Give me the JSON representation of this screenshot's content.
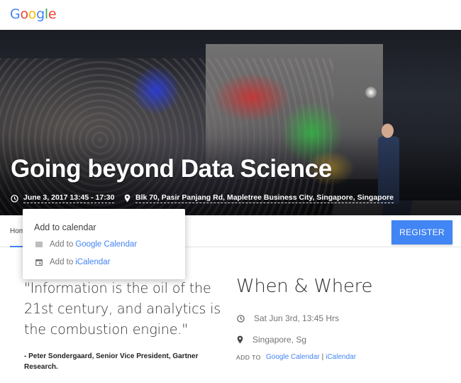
{
  "header": {
    "logo_letters": [
      {
        "ch": "G",
        "color": "#4285f4"
      },
      {
        "ch": "o",
        "color": "#ea4335"
      },
      {
        "ch": "o",
        "color": "#fbbc05"
      },
      {
        "ch": "g",
        "color": "#4285f4"
      },
      {
        "ch": "l",
        "color": "#34a853"
      },
      {
        "ch": "e",
        "color": "#ea4335"
      }
    ]
  },
  "hero": {
    "title": "Going beyond Data Science",
    "datetime": "June 3, 2017 13:45 - 17:30",
    "location": "Blk 70, Pasir Panjang Rd, Mapletree Business City, Singapore, Singapore",
    "datetime_icon": "clock-icon",
    "location_icon": "location-pin-icon"
  },
  "nav": {
    "home_label": "Hom",
    "register_label": "REGISTER"
  },
  "calendar_popup": {
    "title": "Add to calendar",
    "items": [
      {
        "prefix": "Add to",
        "link": "Google Calendar",
        "icon": "google-calendar-icon"
      },
      {
        "prefix": "Add to",
        "link": "iCalendar",
        "icon": "calendar-icon"
      }
    ]
  },
  "quote": {
    "text": "\"Information is the oil of the 21st century, and analytics is the combustion engine.\"",
    "author": "- Peter Sondergaard, Senior Vice President, Gartner Research."
  },
  "when_where": {
    "title": "When & Where",
    "date": "Sat Jun 3rd, 13:45 Hrs",
    "place": "Singapore, Sg",
    "add_to_label": "ADD TO",
    "google_calendar": "Google Calendar",
    "separator": "|",
    "icalendar": "iCalendar"
  },
  "colors": {
    "accent": "#4285f4",
    "text": "#333333",
    "muted": "#757575"
  }
}
